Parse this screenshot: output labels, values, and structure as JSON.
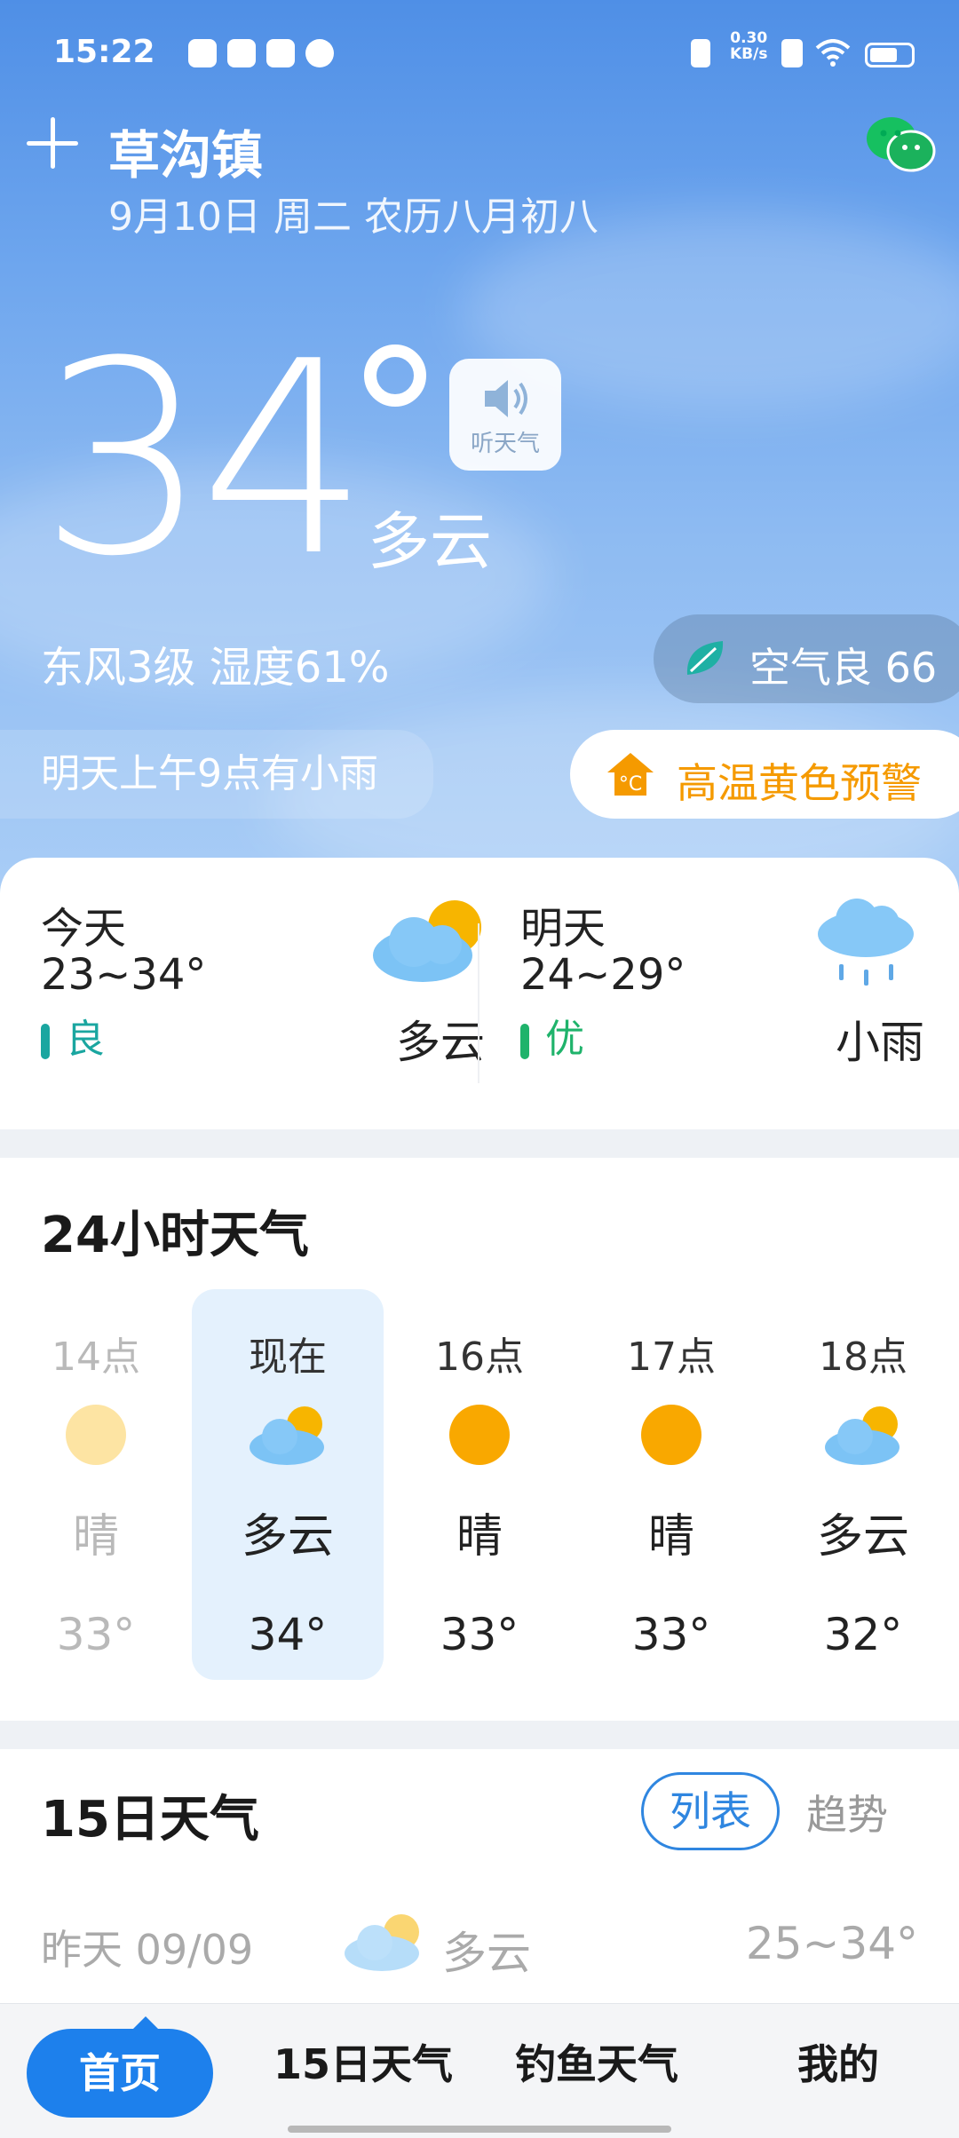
{
  "status_bar": {
    "time": "15:22",
    "net_speed_value": "0.30",
    "net_speed_unit": "KB/s"
  },
  "header": {
    "location": "草沟镇",
    "date": "9月10日 周二 农历八月初八"
  },
  "current": {
    "temperature": "34",
    "condition": "多云",
    "listen_label": "听天气",
    "wind_humidity": "东风3级 湿度61%",
    "air_quality": "空气良 66",
    "rain_note": "明天上午9点有小雨",
    "alert": "高温黄色预警"
  },
  "today": {
    "label": "今天",
    "range": "23~34°",
    "aq": "良",
    "aq_color": "#1aa6a0",
    "condition": "多云",
    "icon": "partly-cloudy-icon"
  },
  "tomorrow": {
    "label": "明天",
    "range": "24~29°",
    "aq": "优",
    "aq_color": "#1fb36b",
    "condition": "小雨",
    "icon": "light-rain-icon"
  },
  "hourly": {
    "title": "24小时天气",
    "hours": [
      {
        "hour": "14点",
        "condition": "晴",
        "temp": "33°",
        "icon": "sunny-icon"
      },
      {
        "hour": "现在",
        "condition": "多云",
        "temp": "34°",
        "icon": "partly-cloudy-icon"
      },
      {
        "hour": "16点",
        "condition": "晴",
        "temp": "33°",
        "icon": "sunny-icon"
      },
      {
        "hour": "17点",
        "condition": "晴",
        "temp": "33°",
        "icon": "sunny-icon"
      },
      {
        "hour": "18点",
        "condition": "多云",
        "temp": "32°",
        "icon": "partly-cloudy-icon"
      }
    ]
  },
  "forecast15": {
    "title": "15日天气",
    "toggle_list": "列表",
    "toggle_trend": "趋势",
    "yesterday": {
      "label": "昨天 09/09",
      "condition": "多云",
      "range": "25~34°"
    }
  },
  "nav": {
    "home": "首页",
    "days15": "15日天气",
    "fishing": "钓鱼天气",
    "mine": "我的"
  },
  "colors": {
    "accent": "#1d80ec",
    "alert": "#f59a00",
    "sky_top": "#4f8fe6"
  }
}
